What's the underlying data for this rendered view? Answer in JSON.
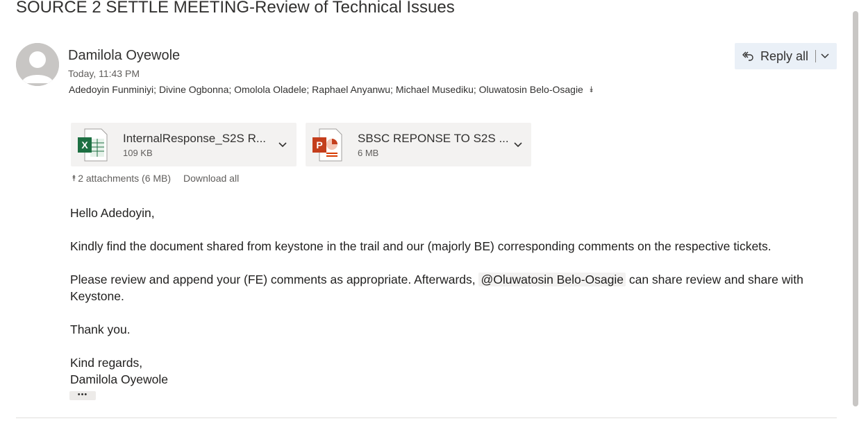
{
  "subject": "SOURCE 2 SETTLE MEETING-Review of Technical Issues",
  "sender": {
    "name": "Damilola Oyewole",
    "datetime": "Today, 11:43 PM",
    "recipients": "Adedoyin Funminiyi; Divine Ogbonna; Omolola Oladele; Raphael Anyanwu; Michael Musediku; Oluwatosin Belo-Osagie"
  },
  "actions": {
    "reply_all": "Reply all"
  },
  "attachments": [
    {
      "name": "InternalResponse_S2S R...",
      "size": "109 KB",
      "type": "excel",
      "icon": "excel-icon"
    },
    {
      "name": "SBSC REPONSE TO S2S ...",
      "size": "6 MB",
      "type": "powerpoint",
      "icon": "powerpoint-icon"
    }
  ],
  "attachments_summary": {
    "count_label": "2 attachments (6 MB)",
    "download_all": "Download all"
  },
  "body": {
    "greeting": "Hello Adedoyin,",
    "para1": "Kindly find the document shared from keystone in the trail and our (majorly BE) corresponding comments on the respective tickets.",
    "para2_before": "Please review and append your (FE) comments as appropriate. Afterwards, ",
    "mention": "@Oluwatosin Belo-Osagie",
    "para2_after": " can share review and share with Keystone.",
    "thanks": "Thank you.",
    "closing": "Kind regards,",
    "signature": "Damilola Oyewole"
  },
  "more_label": "•••",
  "colors": {
    "excel_green": "#1d6f42",
    "powerpoint_red": "#c43e1c",
    "reply_bg": "#eaf0f7"
  }
}
